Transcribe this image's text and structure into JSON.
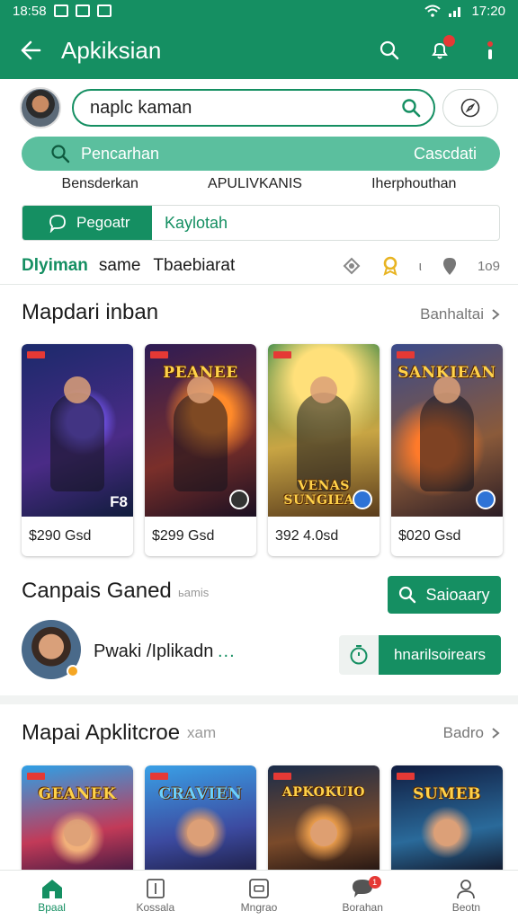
{
  "status_bar": {
    "time_left": "18:58",
    "time_right": "17:20"
  },
  "app_bar": {
    "title": "Apkiksian"
  },
  "search": {
    "value": "naplc kaman"
  },
  "pill": {
    "label": "Pencarhan",
    "action": "Cascdati"
  },
  "categories": [
    "Bensderkan",
    "APULIVKANIS",
    "Iherphouthan"
  ],
  "segmented": {
    "active": "Pegoatr",
    "inactive": "Kaylotah"
  },
  "info_row": {
    "green": "Dlyiman",
    "middle": "same",
    "third": "Tbaebiarat",
    "count": "1о9"
  },
  "section1": {
    "title": "Mapdari inban",
    "link": "Banhaltai",
    "cards": [
      {
        "art": "",
        "corner": "F8",
        "price": "$290 Gsd"
      },
      {
        "art": "PEANEE",
        "corner": "",
        "price": "$299 Gsd"
      },
      {
        "art": "VENAS SUNGIEAS",
        "corner": "",
        "price": "392 4.0sd"
      },
      {
        "art": "SANKIEAN",
        "corner": "",
        "price": "$020 Gsd"
      }
    ]
  },
  "campaign": {
    "title": "Canpais Ganed",
    "subtitle": "ьamis",
    "search_button": "Saioaary",
    "user_name": "Pwaki /Iplikadn",
    "user_dots": "...",
    "action_button": "hnarilsoirears"
  },
  "section2": {
    "title": "Mapai Apklitcroe",
    "subtitle": "xam",
    "link": "Badro",
    "cards": [
      {
        "art": "GEANEK"
      },
      {
        "art": "CRAVIEN"
      },
      {
        "art": "APKOKUIO"
      },
      {
        "art": "SUMEB"
      }
    ]
  },
  "bottom_nav": [
    {
      "label": "Bpaal",
      "icon": "home-icon"
    },
    {
      "label": "Kossala",
      "icon": "document-icon"
    },
    {
      "label": "Mngrao",
      "icon": "app-icon"
    },
    {
      "label": "Borahan",
      "icon": "chat-icon",
      "badge": "1"
    },
    {
      "label": "Beotn",
      "icon": "user-icon"
    }
  ],
  "colors": {
    "primary": "#158f62",
    "pill": "#5bbf9e",
    "badge": "#e53935"
  }
}
